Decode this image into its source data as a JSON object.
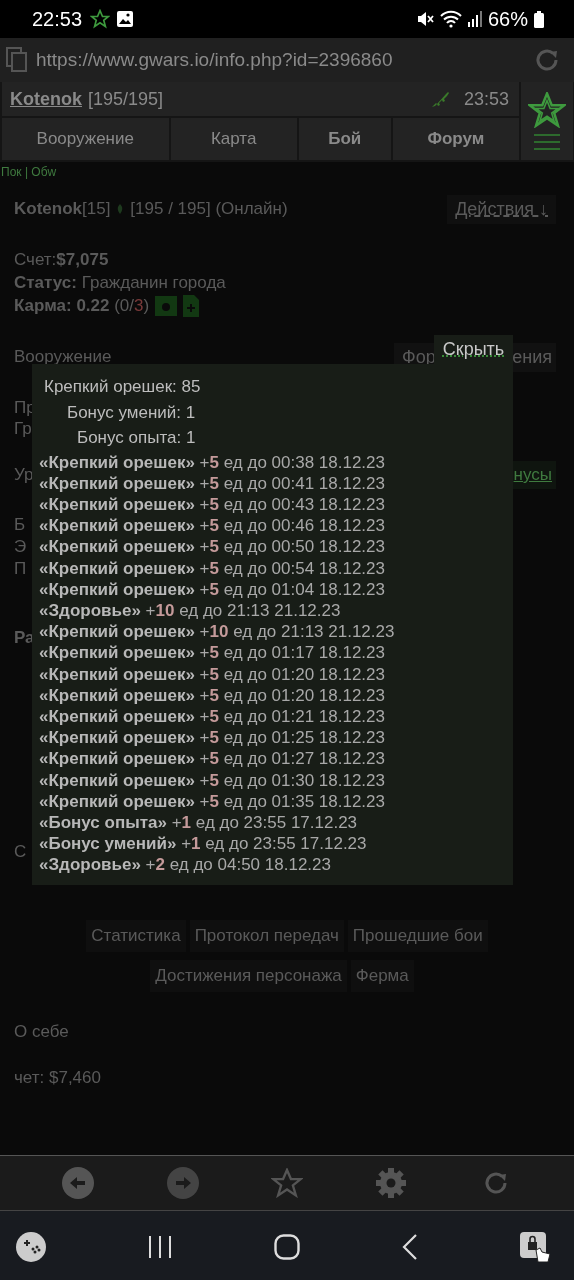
{
  "status_bar": {
    "time": "22:53",
    "battery": "66%"
  },
  "browser": {
    "url": "https://www.gwars.io/info.php?id=2396860"
  },
  "header": {
    "name": "Kotenok",
    "hp": "[195/195]",
    "time": "23:53"
  },
  "nav_tabs": [
    {
      "label": "Вооружение",
      "bold": false
    },
    {
      "label": "Карта",
      "bold": false
    },
    {
      "label": "Бой",
      "bold": true
    },
    {
      "label": "Форум",
      "bold": true
    }
  ],
  "page": {
    "crumbs": "Пок | Обw",
    "player": "Kotenok",
    "level": "[15]",
    "hp_status": "[195 / 195] (Онлайн)",
    "actions": "Действия ↓",
    "account": {
      "label": "Счет:",
      "value": "$7,075"
    },
    "status": {
      "label": "Статус:",
      "value": "Гражданин города"
    },
    "karma": {
      "label": "Карма:",
      "value": "0.22",
      "open": "(0/",
      "bad": "3",
      "close": ")"
    },
    "armor": "Вооружение",
    "armor_button_left": "Фор",
    "armor_button_right": "ения",
    "frag_a": [
      "Пр",
      "Гр"
    ],
    "frag_b": "Ур",
    "bonus_link": "нусы",
    "frag_c": [
      "Б",
      "Э",
      "П"
    ],
    "frag_d": "Ра",
    "frag_e": "С",
    "tabs_row_1": [
      "Статистика",
      "Протокол передач",
      "Прошедшие бои"
    ],
    "tabs_row_2": [
      "Достижения персонажа",
      "Ферма"
    ],
    "about": "О себе",
    "account_2": "чет: $7,460"
  },
  "popup": {
    "hide": "Скрыть",
    "stats": [
      {
        "label": "Крепкий орешек:",
        "value": "85"
      },
      {
        "label": "Бонус умений:",
        "value": "1"
      },
      {
        "label": "Бонус опыта:",
        "value": "1"
      }
    ],
    "entries": [
      {
        "name": "«Крепкий орешек»",
        "amount": "+5",
        "rest": "ед до 00:38 18.12.23"
      },
      {
        "name": "«Крепкий орешек»",
        "amount": "+5",
        "rest": "ед до 00:41 18.12.23"
      },
      {
        "name": "«Крепкий орешек»",
        "amount": "+5",
        "rest": "ед до 00:43 18.12.23"
      },
      {
        "name": "«Крепкий орешек»",
        "amount": "+5",
        "rest": "ед до 00:46 18.12.23"
      },
      {
        "name": "«Крепкий орешек»",
        "amount": "+5",
        "rest": "ед до 00:50 18.12.23"
      },
      {
        "name": "«Крепкий орешек»",
        "amount": "+5",
        "rest": "ед до 00:54 18.12.23"
      },
      {
        "name": "«Крепкий орешек»",
        "amount": "+5",
        "rest": "ед до 01:04 18.12.23"
      },
      {
        "name": "«Здоровье»",
        "amount": "+10",
        "rest": "ед до 21:13 21.12.23"
      },
      {
        "name": "«Крепкий орешек»",
        "amount": "+10",
        "rest": "ед до 21:13 21.12.23"
      },
      {
        "name": "«Крепкий орешек»",
        "amount": "+5",
        "rest": "ед до 01:17 18.12.23"
      },
      {
        "name": "«Крепкий орешек»",
        "amount": "+5",
        "rest": "ед до 01:20 18.12.23"
      },
      {
        "name": "«Крепкий орешек»",
        "amount": "+5",
        "rest": "ед до 01:20 18.12.23"
      },
      {
        "name": "«Крепкий орешек»",
        "amount": "+5",
        "rest": "ед до 01:21 18.12.23"
      },
      {
        "name": "«Крепкий орешек»",
        "amount": "+5",
        "rest": "ед до 01:25 18.12.23"
      },
      {
        "name": "«Крепкий орешек»",
        "amount": "+5",
        "rest": "ед до 01:27 18.12.23"
      },
      {
        "name": "«Крепкий орешек»",
        "amount": "+5",
        "rest": "ед до 01:30 18.12.23"
      },
      {
        "name": "«Крепкий орешек»",
        "amount": "+5",
        "rest": "ед до 01:35 18.12.23"
      },
      {
        "name": "«Бонус опыта»",
        "amount": "+1",
        "rest": "ед до 23:55 17.12.23"
      },
      {
        "name": "«Бонус умений»",
        "amount": "+1",
        "rest": "ед до 23:55 17.12.23"
      },
      {
        "name": "«Здоровье»",
        "amount": "+2",
        "rest": "ед до 04:50 18.12.23"
      }
    ]
  }
}
